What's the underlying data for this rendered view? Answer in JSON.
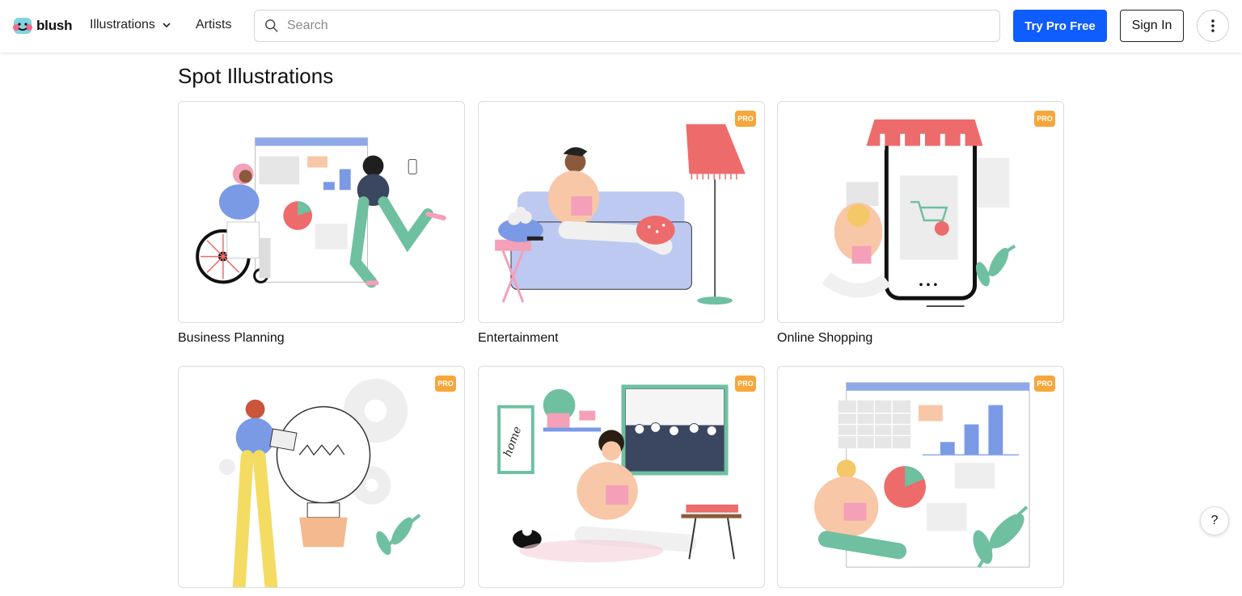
{
  "brand": {
    "name": "blush"
  },
  "nav": {
    "illustrations": "Illustrations",
    "artists": "Artists"
  },
  "search": {
    "placeholder": "Search",
    "value": ""
  },
  "actions": {
    "try_pro": "Try Pro Free",
    "sign_in": "Sign In",
    "more": "⋮"
  },
  "page": {
    "title": "Spot Illustrations"
  },
  "cards": [
    {
      "title": "Business Planning",
      "pro": false
    },
    {
      "title": "Entertainment",
      "pro": true
    },
    {
      "title": "Online Shopping",
      "pro": true
    },
    {
      "title": "",
      "pro": true
    },
    {
      "title": "",
      "pro": true
    },
    {
      "title": "",
      "pro": true
    }
  ],
  "badge": {
    "pro": "PRO"
  },
  "help": {
    "label": "?"
  },
  "colors": {
    "accent": "#0f5cff",
    "pro_badge": "#f6a73a"
  }
}
